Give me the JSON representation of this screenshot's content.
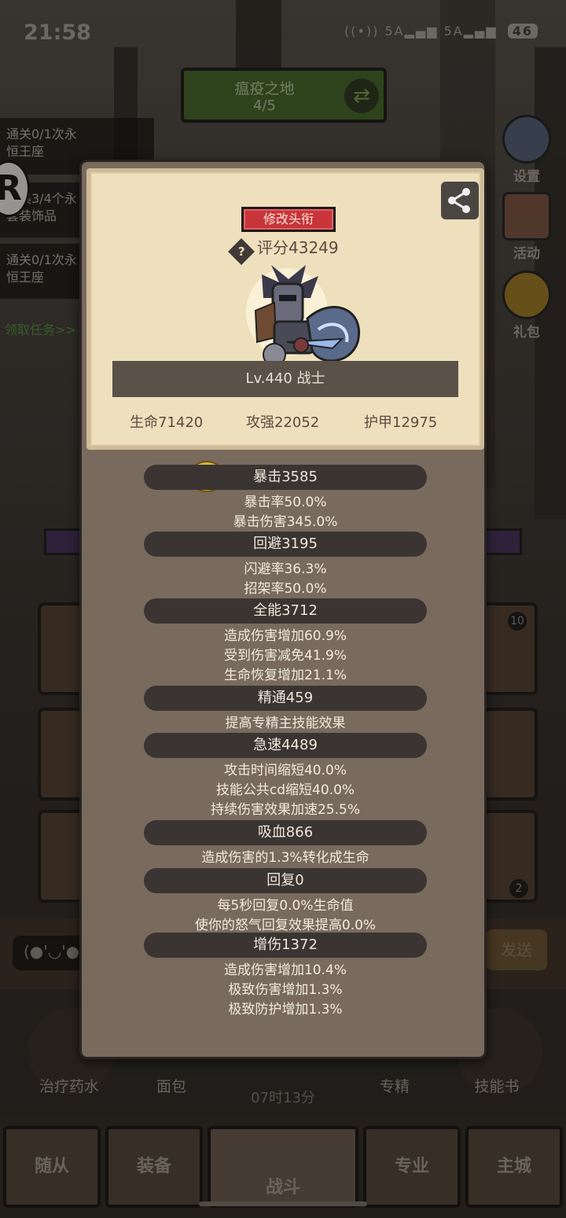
{
  "status_bar": {
    "time": "21:58",
    "signal_1": "5A",
    "signal_2": "5A",
    "battery": "46"
  },
  "zone": {
    "name": "瘟疫之地",
    "progress": "4/5"
  },
  "quests": [
    {
      "line1": "通关0/1次永",
      "line2": "恒王座"
    },
    {
      "line1": "收集3/4个永",
      "line2": "套装饰品"
    },
    {
      "line1": "通关0/1次永",
      "line2": "恒王座"
    }
  ],
  "quest_link": "领取任务>>",
  "side_buttons": {
    "settings": "设置",
    "events": "活动",
    "gift": "礼包"
  },
  "chat": {
    "input_value": "(●'◡'●",
    "send": "发送"
  },
  "quick_items": [
    "治疗药水",
    "面包",
    "专精",
    "技能书"
  ],
  "timer": "07时13分",
  "bottom_nav": [
    "随从",
    "装备",
    "战斗",
    "专业",
    "主城"
  ],
  "profile": {
    "title_button": "修改头衔",
    "score": "评分43249",
    "level_class": "Lv.440 战士",
    "hp": "生命71420",
    "attack": "攻强22052",
    "armor": "护甲12975"
  },
  "stats": [
    {
      "header": "暴击3585",
      "lines": [
        "暴击率50.0%",
        "暴击伤害345.0%"
      ]
    },
    {
      "header": "回避3195",
      "lines": [
        "闪避率36.3%",
        "招架率50.0%"
      ]
    },
    {
      "header": "全能3712",
      "lines": [
        "造成伤害增加60.9%",
        "受到伤害减免41.9%",
        "生命恢复增加21.1%"
      ]
    },
    {
      "header": "精通459",
      "lines": [
        "提高专精主技能效果"
      ]
    },
    {
      "header": "急速4489",
      "lines": [
        "攻击时间缩短40.0%",
        "技能公共cd缩短40.0%",
        "持续伤害效果加速25.5%"
      ]
    },
    {
      "header": "吸血866",
      "lines": [
        "造成伤害的1.3%转化成生命"
      ]
    },
    {
      "header": "回复0",
      "lines": [
        "每5秒回复0.0%生命值",
        "使你的怒气回复效果提高0.0%"
      ]
    },
    {
      "header": "增伤1372",
      "lines": [
        "造成伤害增加10.4%",
        "极致伤害增加1.3%",
        "极致防护增加1.3%"
      ]
    }
  ],
  "slot_badges": [
    "10",
    "2"
  ],
  "colors": {
    "title_red": "#c8343a",
    "card_bg": "#eedfbd",
    "panel_bg": "#786b5d"
  }
}
